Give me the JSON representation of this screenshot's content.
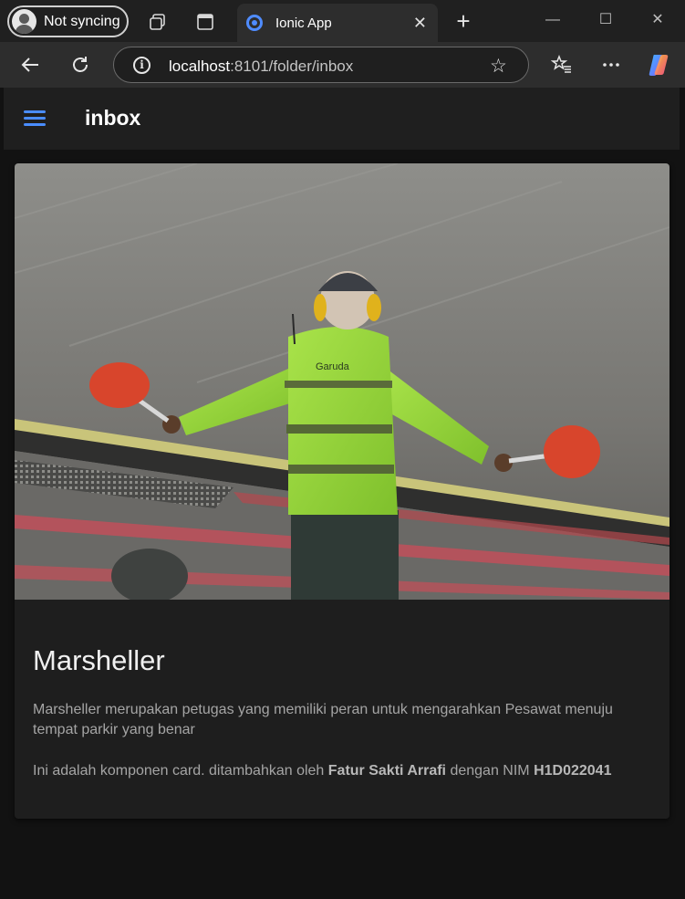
{
  "browser": {
    "profile_label": "Not syncing",
    "tab_title": "Ionic App",
    "new_tab_symbol": "+",
    "url_host": "localhost",
    "url_rest": ":8101/folder/inbox",
    "icons": [
      "profile-avatar-icon",
      "workspaces-icon",
      "tab-actions-icon",
      "ionic-favicon",
      "close-icon",
      "plus-icon",
      "minimize-icon",
      "maximize-icon",
      "window-close-icon",
      "back-arrow-icon",
      "reload-icon",
      "info-icon",
      "favorite-star-icon",
      "favorites-list-icon",
      "more-dots-icon",
      "copilot-icon"
    ]
  },
  "app": {
    "header_title": "inbox",
    "accent_color": "#4a8dff",
    "card": {
      "image_alt": "Marshaller with green vest holding red paddles on airport apron",
      "title": "Marsheller",
      "subtitle": "Marsheller merupakan petugas yang memiliki peran untuk mengarahkan Pesawat menuju tempat parkir yang benar",
      "content_prefix": "Ini adalah komponen card. ditambahkan oleh ",
      "author": "Fatur Sakti Arrafi",
      "content_mid": " dengan NIM ",
      "nim": "H1D022041"
    }
  },
  "image_text": {
    "vest_logo": "Garuda"
  }
}
